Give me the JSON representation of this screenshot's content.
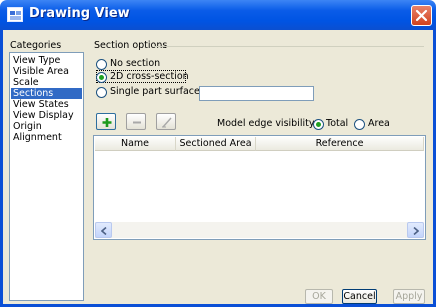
{
  "window": {
    "title": "Drawing View"
  },
  "categories": {
    "label": "Categories",
    "items": [
      "View Type",
      "Visible Area",
      "Scale",
      "Sections",
      "View States",
      "View Display",
      "Origin",
      "Alignment"
    ],
    "selected": "Sections"
  },
  "section_options": {
    "label": "Section options",
    "radios": [
      "No section",
      "2D cross-section",
      "Single part surface"
    ],
    "selected": "2D cross-section",
    "surface_value": ""
  },
  "toolbar": {
    "add_icon": "plus-icon",
    "remove_icon": "minus-icon",
    "edit_icon": "slash-icon"
  },
  "edge_visibility": {
    "label": "Model edge visibility",
    "options": [
      "Total",
      "Area"
    ],
    "selected": "Total"
  },
  "table": {
    "columns": [
      "Name",
      "Sectioned Area",
      "Reference"
    ]
  },
  "buttons": {
    "ok": "OK",
    "cancel": "Cancel",
    "apply": "Apply"
  }
}
